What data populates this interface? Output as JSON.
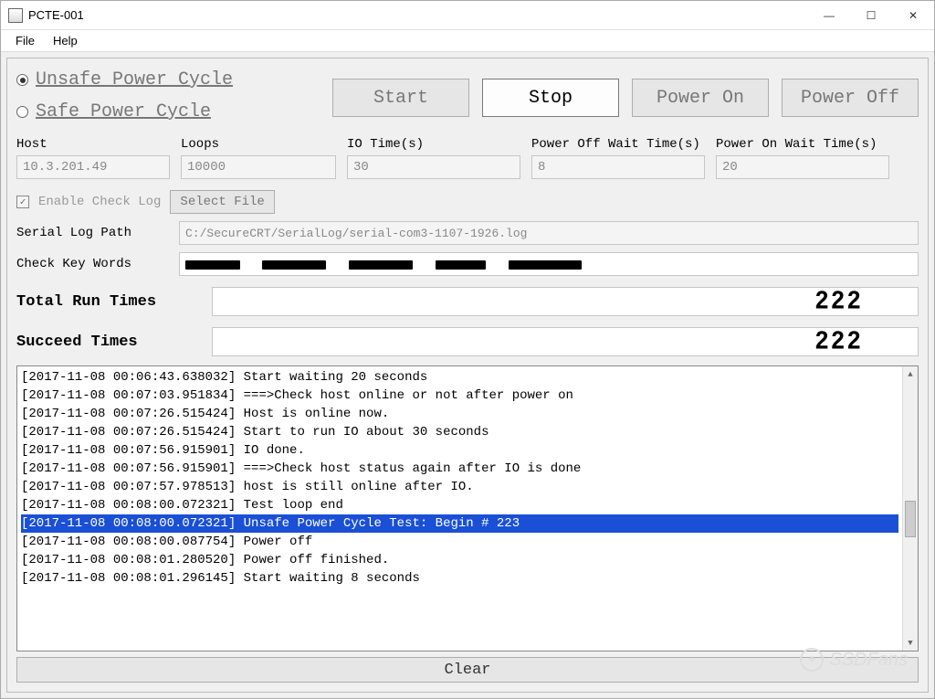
{
  "window": {
    "title": "PCTE-001"
  },
  "menu": {
    "file": "File",
    "help": "Help"
  },
  "modes": {
    "unsafe": "Unsafe Power Cycle",
    "safe": "Safe Power Cycle",
    "selected": "unsafe"
  },
  "buttons": {
    "start": "Start",
    "stop": "Stop",
    "power_on": "Power On",
    "power_off": "Power Off",
    "select_file": "Select File",
    "clear": "Clear"
  },
  "params": {
    "host_label": "Host",
    "host": "10.3.201.49",
    "loops_label": "Loops",
    "loops": "10000",
    "io_time_label": "IO Time(s)",
    "io_time": "30",
    "poff_wait_label": "Power Off Wait Time(s)",
    "poff_wait": "8",
    "pon_wait_label": "Power On Wait Time(s)",
    "pon_wait": "20"
  },
  "checklog": {
    "label": "Enable Check Log",
    "checked": true
  },
  "serial_log": {
    "label": "Serial Log Path",
    "path": "C:/SecureCRT/SerialLog/serial-com3-1107-1926.log"
  },
  "keywords": {
    "label": "Check Key Words"
  },
  "counters": {
    "total_label": "Total Run Times",
    "total": "222",
    "succeed_label": "Succeed Times",
    "succeed": "222"
  },
  "log": [
    {
      "t": "2017-11-08 00:06:43.638032",
      "m": "Start waiting 20 seconds",
      "hl": false
    },
    {
      "t": "2017-11-08 00:07:03.951834",
      "m": "===>Check host online or not after power on",
      "hl": false
    },
    {
      "t": "2017-11-08 00:07:26.515424",
      "m": "Host is online now.",
      "hl": false
    },
    {
      "t": "2017-11-08 00:07:26.515424",
      "m": "Start to run IO about 30 seconds",
      "hl": false
    },
    {
      "t": "2017-11-08 00:07:56.915901",
      "m": "IO done.",
      "hl": false
    },
    {
      "t": "2017-11-08 00:07:56.915901",
      "m": "===>Check host status again after IO is done",
      "hl": false
    },
    {
      "t": "2017-11-08 00:07:57.978513",
      "m": "host is still online after IO.",
      "hl": false
    },
    {
      "t": "2017-11-08 00:08:00.072321",
      "m": "Test loop end",
      "hl": false
    },
    {
      "t": "2017-11-08 00:08:00.072321",
      "m": "Unsafe Power Cycle Test: Begin # 223",
      "hl": true
    },
    {
      "t": "2017-11-08 00:08:00.087754",
      "m": "Power off",
      "hl": false
    },
    {
      "t": "2017-11-08 00:08:01.280520",
      "m": "Power off finished.",
      "hl": false
    },
    {
      "t": "2017-11-08 00:08:01.296145",
      "m": "Start waiting 8 seconds",
      "hl": false
    }
  ],
  "watermark": "SSDFans"
}
